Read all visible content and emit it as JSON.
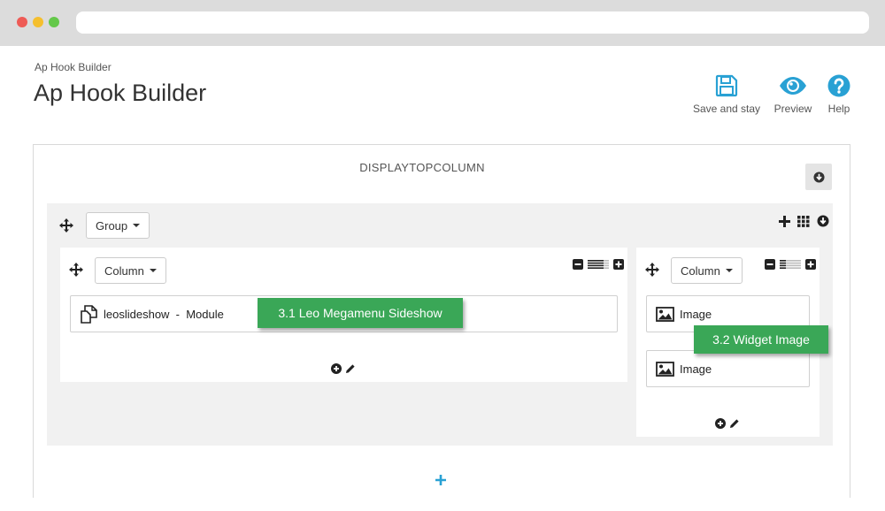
{
  "page": {
    "breadcrumb": "Ap Hook Builder",
    "title": "Ap Hook Builder"
  },
  "toolbar": {
    "save_label": "Save and stay",
    "preview_label": "Preview",
    "help_label": "Help"
  },
  "hook": {
    "name": "DISPLAYTOPCOLUMN",
    "group": {
      "label": "Group",
      "columns": [
        {
          "label": "Column",
          "widgets": [
            {
              "label": "leoslideshow  -  Module",
              "icon": "module-icon"
            }
          ]
        },
        {
          "label": "Column",
          "widgets": [
            {
              "label": "Image",
              "icon": "image-icon"
            },
            {
              "label": "Image",
              "icon": "image-icon"
            }
          ]
        }
      ]
    }
  },
  "callouts": [
    {
      "text": "3.1 Leo Megamenu Sideshow"
    },
    {
      "text": "3.2 Widget Image"
    }
  ],
  "colors": {
    "accent": "#29a1d4",
    "callout": "#3aa757"
  }
}
